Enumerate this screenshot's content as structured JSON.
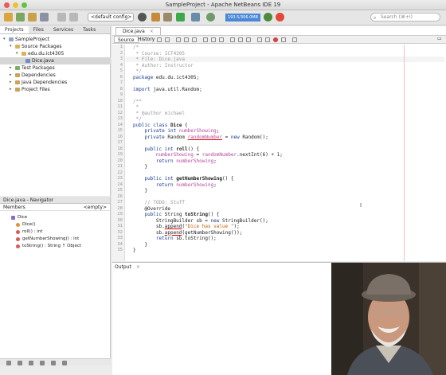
{
  "window": {
    "title": "SampleProject - Apache NetBeans IDE 19"
  },
  "toolbar": {
    "config": "<default config>",
    "memory": "193.5/306.0MB",
    "search_placeholder": "Search (⌘+I)"
  },
  "projects_panel": {
    "tabs": [
      "Projects",
      "Files",
      "Services",
      "Tasks"
    ],
    "tree": [
      {
        "label": "SampleProject",
        "indent": 0
      },
      {
        "label": "Source Packages",
        "indent": 1
      },
      {
        "label": "edu.du.ict4305",
        "indent": 2
      },
      {
        "label": "Dice.java",
        "indent": 3,
        "selected": true
      },
      {
        "label": "Test Packages",
        "indent": 1
      },
      {
        "label": "Dependencies",
        "indent": 1
      },
      {
        "label": "Java Dependencies",
        "indent": 1
      },
      {
        "label": "Project Files",
        "indent": 1
      }
    ]
  },
  "navigator": {
    "title": "Dice.java - Navigator",
    "filter_label": "Members",
    "filter_value": "<empty>",
    "items": [
      {
        "label": "Dice",
        "indent": 0
      },
      {
        "label": "Dice()",
        "indent": 1
      },
      {
        "label": "roll() : int",
        "indent": 1
      },
      {
        "label": "getNumberShowing() : int",
        "indent": 1
      },
      {
        "label": "toString() : String ↑ Object",
        "indent": 1
      }
    ]
  },
  "editor": {
    "tab": "Dice.java",
    "source_tab": "Source",
    "history_tab": "History",
    "line_numbers": [
      "1",
      "2",
      "3",
      "4",
      "5",
      "6",
      "7",
      "8",
      "9",
      "10",
      "11",
      "12",
      "13",
      "14",
      "15",
      "16",
      "17",
      "18",
      "19",
      "20",
      "21",
      "22",
      "23",
      "24",
      "25",
      "26",
      "27",
      "28",
      "29",
      "30",
      "31",
      "32",
      "33",
      "34",
      "35"
    ]
  },
  "output": {
    "tab": "Output"
  },
  "colors": {
    "keyword": "#1b3d91",
    "comment": "#999999",
    "string": "#c35f00",
    "field": "#b5489d",
    "memory_bar": "#4a87d6"
  }
}
